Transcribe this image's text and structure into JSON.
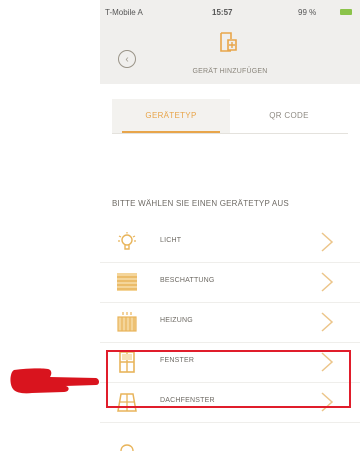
{
  "status_bar": {
    "carrier": "T-Mobile A",
    "time": "15:57",
    "battery": "99 %"
  },
  "header": {
    "back_icon": "back-arrow-icon",
    "device_icon": "add-device-icon",
    "title": "GERÄT HINZUFÜGEN"
  },
  "tabs": [
    {
      "label": "GERÄTETYP",
      "active": true
    },
    {
      "label": "QR CODE",
      "active": false
    }
  ],
  "prompt": "BITTE WÄHLEN SIE EINEN GERÄTETYP AUS",
  "device_types": [
    {
      "label": "LICHT",
      "icon": "light-bulb-icon"
    },
    {
      "label": "BESCHATTUNG",
      "icon": "shading-blind-icon"
    },
    {
      "label": "HEIZUNG",
      "icon": "heating-radiator-icon"
    },
    {
      "label": "FENSTER",
      "icon": "window-icon",
      "highlighted": true
    },
    {
      "label": "DACHFENSTER",
      "icon": "roof-window-icon"
    }
  ],
  "colors": {
    "accent": "#e8a54a",
    "highlight": "#e01d2b",
    "icon": "#e8b45a"
  }
}
